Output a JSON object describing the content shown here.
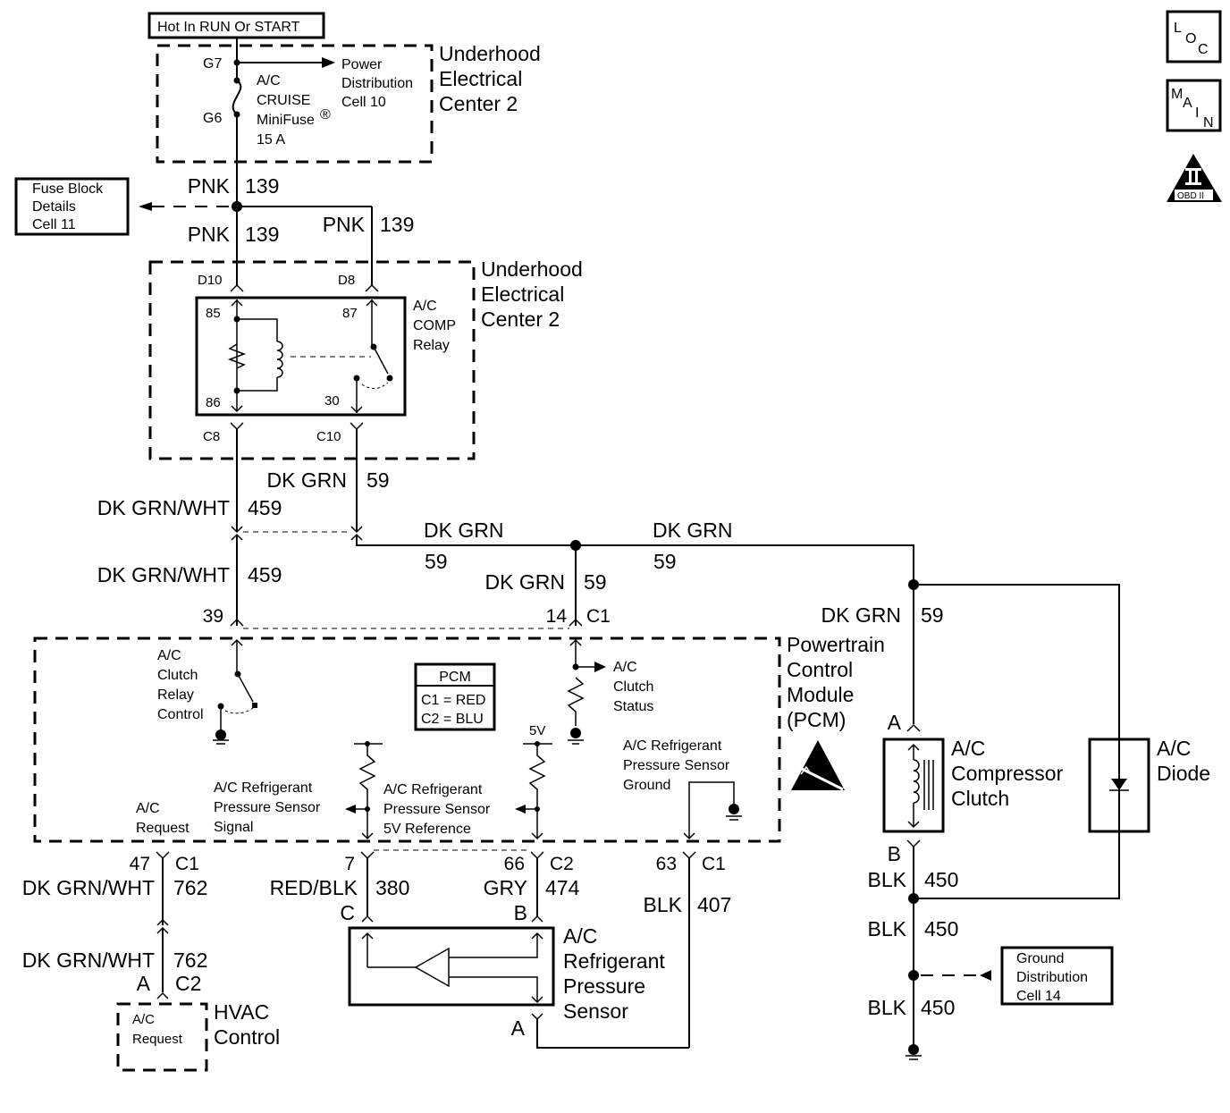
{
  "title_box": "Hot In RUN Or START",
  "nav_icons": {
    "loc": [
      "L",
      "O",
      "C"
    ],
    "main": [
      "M",
      "A",
      "I",
      "N"
    ],
    "obd": {
      "numeral": "II",
      "label": "OBD II"
    }
  },
  "uec_top": {
    "name": [
      "Underhood",
      "Electrical",
      "Center 2"
    ],
    "pins": {
      "g7": "G7",
      "g6": "G6"
    },
    "fuse": [
      "A/C",
      "CRUISE",
      "MiniFuse",
      "15 A"
    ],
    "fuse_mark": "®",
    "power_ref": [
      "Power",
      "Distribution",
      "Cell 10"
    ]
  },
  "fuse_block_ref": [
    "Fuse Block",
    "Details",
    "Cell 11"
  ],
  "wires": {
    "pnk_color": "PNK",
    "pnk_circuit": "139",
    "dkgrnwht_color": "DK GRN/WHT",
    "dkgrnwht_circuit": "459",
    "dkgrn_color": "DK GRN",
    "dkgrn_circuit": "59",
    "req_color": "DK GRN/WHT",
    "req_circuit": "762",
    "sig_color": "RED/BLK",
    "sig_circuit": "380",
    "ref_color": "GRY",
    "ref_circuit": "474",
    "gnd_color": "BLK",
    "gnd_circuit": "407",
    "clutch_gnd_color": "BLK",
    "clutch_gnd_circuit": "450"
  },
  "uec_relay": {
    "name": [
      "Underhood",
      "Electrical",
      "Center 2"
    ],
    "relay_name": [
      "A/C",
      "COMP",
      "Relay"
    ],
    "pins": {
      "d10": "D10",
      "d8": "D8",
      "c8": "C8",
      "c10": "C10",
      "p85": "85",
      "p86": "86",
      "p87": "87",
      "p30": "30"
    }
  },
  "pcm": {
    "name": [
      "Powertrain",
      "Control",
      "Module",
      "(PCM)"
    ],
    "legend": {
      "title": "PCM",
      "c1": "C1 = RED",
      "c2": "C2 = BLU"
    },
    "pins": {
      "p39": "39",
      "p14": "14",
      "c1": "C1",
      "p47": "47",
      "p7": "7",
      "p66": "66",
      "c2": "C2",
      "p63": "63",
      "c1b": "C1"
    },
    "clutch_relay": [
      "A/C",
      "Clutch",
      "Relay",
      "Control"
    ],
    "clutch_status": [
      "A/C",
      "Clutch",
      "Status"
    ],
    "ac_request": [
      "A/C",
      "Request"
    ],
    "sensor_signal": [
      "A/C Refrigerant",
      "Pressure Sensor",
      "Signal"
    ],
    "sensor_ref": [
      "A/C Refrigerant",
      "Pressure Sensor",
      "5V Reference"
    ],
    "sensor_ground": [
      "A/C Refrigerant",
      "Pressure Sensor",
      "Ground"
    ],
    "five_v": "5V"
  },
  "hvac": {
    "name": [
      "HVAC",
      "Control"
    ],
    "inner": [
      "A/C",
      "Request"
    ],
    "pins": {
      "a": "A",
      "c2": "C2"
    }
  },
  "sensor": {
    "name": [
      "A/C",
      "Refrigerant",
      "Pressure",
      "Sensor"
    ],
    "pins": {
      "c": "C",
      "b": "B",
      "a": "A"
    }
  },
  "clutch": {
    "name": [
      "A/C",
      "Compressor",
      "Clutch"
    ],
    "pins": {
      "a": "A",
      "b": "B"
    }
  },
  "diode": {
    "name": [
      "A/C",
      "Diode"
    ]
  },
  "ground_ref": [
    "Ground",
    "Distribution",
    "Cell 14"
  ]
}
